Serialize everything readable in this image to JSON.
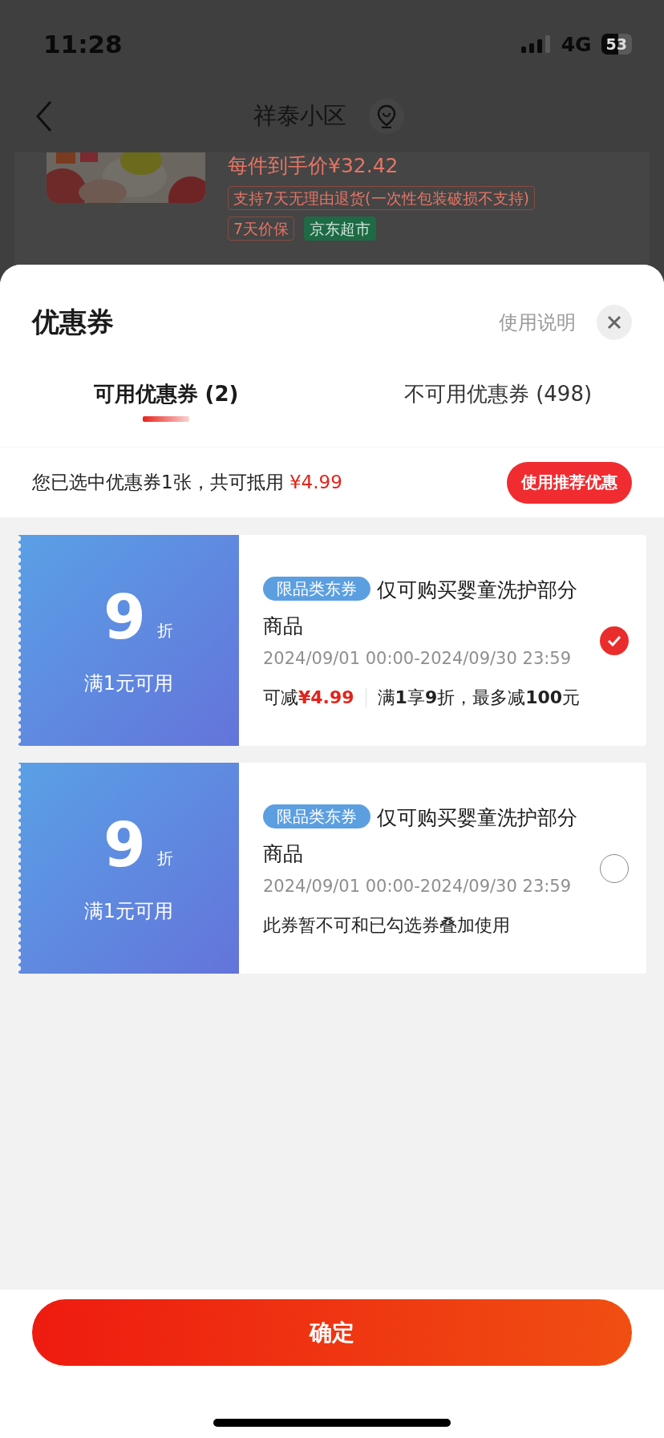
{
  "status_bar": {
    "time": "11:28",
    "network": "4G",
    "battery": "53"
  },
  "nav": {
    "title": "祥泰小区"
  },
  "product": {
    "price_label": "每件到手价",
    "price": "¥32.42",
    "tags": [
      {
        "text": "支持7天无理由退货(一次性包装破损不支持)",
        "kind": "outline"
      },
      {
        "text": "7天价保",
        "kind": "outline"
      },
      {
        "text": "京东超市",
        "kind": "filled"
      }
    ]
  },
  "sheet": {
    "title": "优惠券",
    "help_link": "使用说明"
  },
  "tabs": [
    {
      "label": "可用优惠券 (2)",
      "selected": true
    },
    {
      "label": "不可用优惠券 (498)",
      "selected": false
    }
  ],
  "summary": {
    "text": "您已选中优惠券1张，共可抵用",
    "amount": "¥4.99",
    "button": "使用推荐优惠"
  },
  "coupons": [
    {
      "value": "9",
      "unit": "折",
      "condition": "满1元可用",
      "tag": "限品类东券",
      "title": "仅可购买婴童洗护部分商品",
      "validity": "2024/09/01 00:00-2024/09/30 23:59",
      "checked": true,
      "note": {
        "kind": "savings",
        "label": "可减",
        "amount": "¥4.99",
        "rule": "满**1**享**9**折，最多减**100**元"
      }
    },
    {
      "value": "9",
      "unit": "折",
      "condition": "满1元可用",
      "tag": "限品类东券",
      "title": "仅可购买婴童洗护部分商品",
      "validity": "2024/09/01 00:00-2024/09/30 23:59",
      "checked": false,
      "note": {
        "kind": "warning",
        "text": "此券暂不可和已勾选券叠加使用"
      }
    }
  ],
  "confirm_button": "确定"
}
